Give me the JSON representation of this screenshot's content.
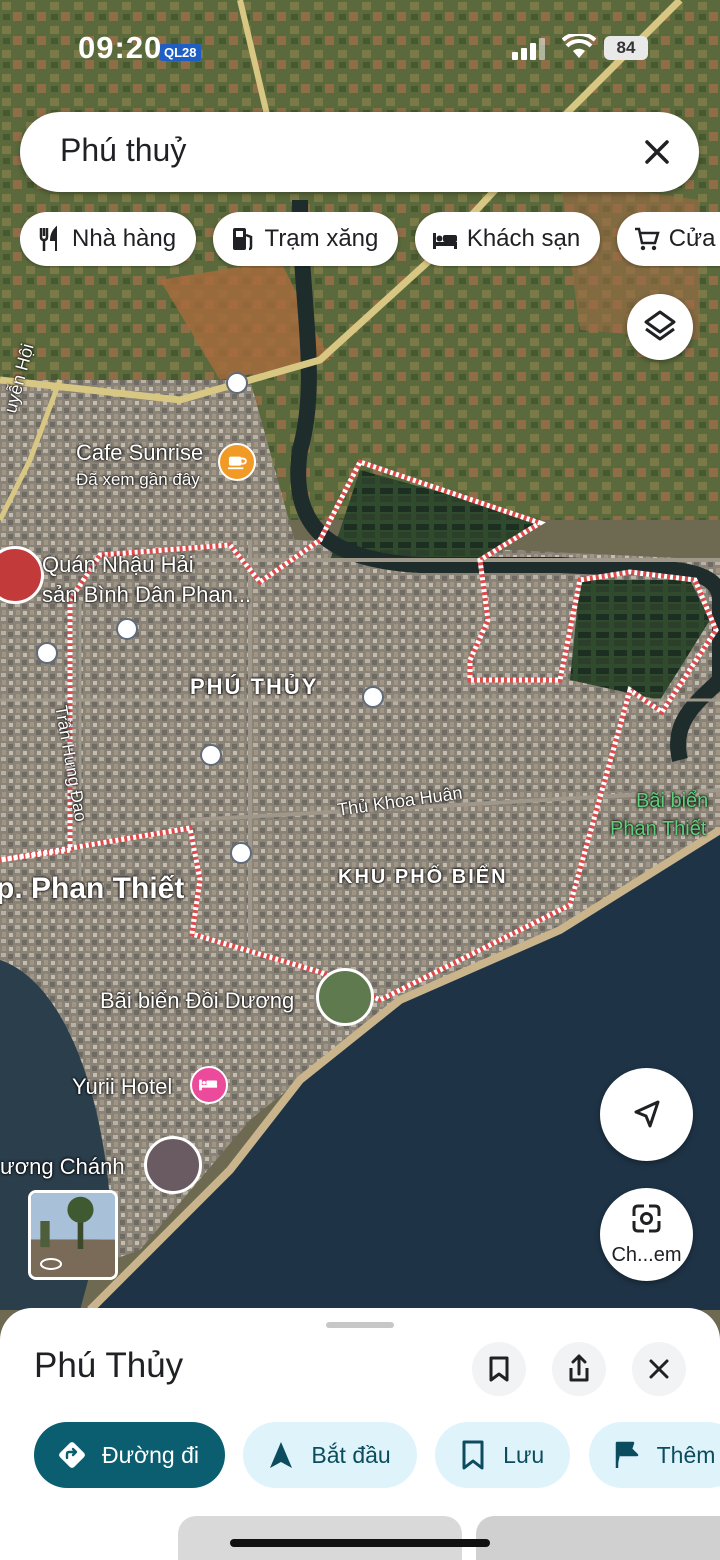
{
  "status": {
    "time": "09:20",
    "ql_badge": "QL28",
    "battery": "84"
  },
  "search": {
    "query": "Phú thuỷ"
  },
  "chips": [
    {
      "label": "Nhà hàng",
      "icon": "restaurant-icon"
    },
    {
      "label": "Trạm xăng",
      "icon": "gas-station-icon"
    },
    {
      "label": "Khách sạn",
      "icon": "hotel-icon"
    },
    {
      "label": "Cửa h",
      "icon": "shopping-cart-icon"
    }
  ],
  "map": {
    "labels": {
      "cafe_name": "Cafe Sunrise",
      "cafe_sub": "Đã xem gần đây",
      "quan_nhau_1": "Quán Nhậu Hải",
      "quan_nhau_2": "sản Bình Dân Phan...",
      "phu_thuy": "PHÚ THỦY",
      "tran_hung_dao": "Trần Hưng Đạo",
      "thu_khoa_huan": "Thủ Khoa Huân",
      "khu_pho_bien": "KHU PHỐ BIỂN",
      "phan_thiet": "p. Phan Thiết",
      "bai_bien_1": "Bãi biển",
      "bai_bien_2": "Phan Thiết",
      "doi_duong": "Bãi biển Đồi Dương",
      "yurii": "Yurii Hotel",
      "thuong_chanh": "ương Chánh",
      "nguyen_hoi": "uyễn Hội"
    },
    "colors": {
      "boundary": "#e24a4a",
      "sea": "#1e3346",
      "cafe_pin": "#f29a26",
      "hotel_pin": "#ec4a9a",
      "beach_label": "#5fd07a"
    }
  },
  "controls": {
    "lens_label": "Ch...em"
  },
  "sheet": {
    "title": "Phú Thủy",
    "actions": [
      {
        "label": "Đường đi",
        "icon": "directions-icon",
        "primary": true
      },
      {
        "label": "Bắt đầu",
        "icon": "navigation-arrow-icon",
        "primary": false
      },
      {
        "label": "Lưu",
        "icon": "bookmark-icon",
        "primary": false
      },
      {
        "label": "Thêm",
        "icon": "flag-icon",
        "primary": false
      }
    ]
  }
}
